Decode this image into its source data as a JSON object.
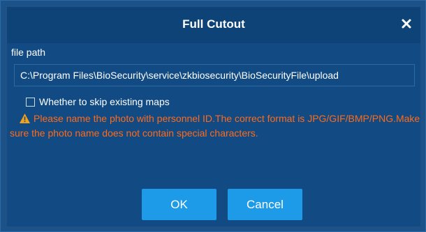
{
  "dialog": {
    "title": "Full Cutout",
    "close_icon": "close-icon"
  },
  "file_path": {
    "label": "file path",
    "value": "C:\\Program Files\\BioSecurity\\service\\zkbiosecurity\\BioSecurityFile\\upload"
  },
  "skip_existing": {
    "label": "Whether to skip existing maps",
    "checked": false
  },
  "warning": {
    "icon": "warning-icon",
    "text": "Please name the photo with personnel ID.The correct format is JPG/GIF/BMP/PNG.Make sure the photo name does not contain special characters."
  },
  "buttons": {
    "ok_label": "OK",
    "cancel_label": "Cancel"
  },
  "colors": {
    "title_bar": "#0d4377",
    "panel": "#124b83",
    "button": "#1e9be8",
    "warning_text": "#ff6a1a"
  }
}
